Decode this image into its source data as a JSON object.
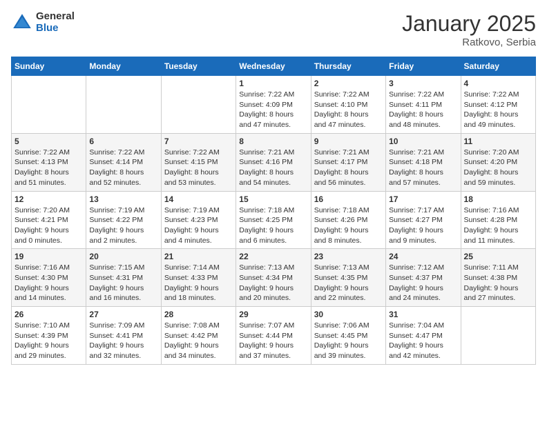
{
  "header": {
    "logo_general": "General",
    "logo_blue": "Blue",
    "title": "January 2025",
    "location": "Ratkovo, Serbia"
  },
  "days_of_week": [
    "Sunday",
    "Monday",
    "Tuesday",
    "Wednesday",
    "Thursday",
    "Friday",
    "Saturday"
  ],
  "weeks": [
    [
      {
        "day": "",
        "info": ""
      },
      {
        "day": "",
        "info": ""
      },
      {
        "day": "",
        "info": ""
      },
      {
        "day": "1",
        "info": "Sunrise: 7:22 AM\nSunset: 4:09 PM\nDaylight: 8 hours\nand 47 minutes."
      },
      {
        "day": "2",
        "info": "Sunrise: 7:22 AM\nSunset: 4:10 PM\nDaylight: 8 hours\nand 47 minutes."
      },
      {
        "day": "3",
        "info": "Sunrise: 7:22 AM\nSunset: 4:11 PM\nDaylight: 8 hours\nand 48 minutes."
      },
      {
        "day": "4",
        "info": "Sunrise: 7:22 AM\nSunset: 4:12 PM\nDaylight: 8 hours\nand 49 minutes."
      }
    ],
    [
      {
        "day": "5",
        "info": "Sunrise: 7:22 AM\nSunset: 4:13 PM\nDaylight: 8 hours\nand 51 minutes."
      },
      {
        "day": "6",
        "info": "Sunrise: 7:22 AM\nSunset: 4:14 PM\nDaylight: 8 hours\nand 52 minutes."
      },
      {
        "day": "7",
        "info": "Sunrise: 7:22 AM\nSunset: 4:15 PM\nDaylight: 8 hours\nand 53 minutes."
      },
      {
        "day": "8",
        "info": "Sunrise: 7:21 AM\nSunset: 4:16 PM\nDaylight: 8 hours\nand 54 minutes."
      },
      {
        "day": "9",
        "info": "Sunrise: 7:21 AM\nSunset: 4:17 PM\nDaylight: 8 hours\nand 56 minutes."
      },
      {
        "day": "10",
        "info": "Sunrise: 7:21 AM\nSunset: 4:18 PM\nDaylight: 8 hours\nand 57 minutes."
      },
      {
        "day": "11",
        "info": "Sunrise: 7:20 AM\nSunset: 4:20 PM\nDaylight: 8 hours\nand 59 minutes."
      }
    ],
    [
      {
        "day": "12",
        "info": "Sunrise: 7:20 AM\nSunset: 4:21 PM\nDaylight: 9 hours\nand 0 minutes."
      },
      {
        "day": "13",
        "info": "Sunrise: 7:19 AM\nSunset: 4:22 PM\nDaylight: 9 hours\nand 2 minutes."
      },
      {
        "day": "14",
        "info": "Sunrise: 7:19 AM\nSunset: 4:23 PM\nDaylight: 9 hours\nand 4 minutes."
      },
      {
        "day": "15",
        "info": "Sunrise: 7:18 AM\nSunset: 4:25 PM\nDaylight: 9 hours\nand 6 minutes."
      },
      {
        "day": "16",
        "info": "Sunrise: 7:18 AM\nSunset: 4:26 PM\nDaylight: 9 hours\nand 8 minutes."
      },
      {
        "day": "17",
        "info": "Sunrise: 7:17 AM\nSunset: 4:27 PM\nDaylight: 9 hours\nand 9 minutes."
      },
      {
        "day": "18",
        "info": "Sunrise: 7:16 AM\nSunset: 4:28 PM\nDaylight: 9 hours\nand 11 minutes."
      }
    ],
    [
      {
        "day": "19",
        "info": "Sunrise: 7:16 AM\nSunset: 4:30 PM\nDaylight: 9 hours\nand 14 minutes."
      },
      {
        "day": "20",
        "info": "Sunrise: 7:15 AM\nSunset: 4:31 PM\nDaylight: 9 hours\nand 16 minutes."
      },
      {
        "day": "21",
        "info": "Sunrise: 7:14 AM\nSunset: 4:33 PM\nDaylight: 9 hours\nand 18 minutes."
      },
      {
        "day": "22",
        "info": "Sunrise: 7:13 AM\nSunset: 4:34 PM\nDaylight: 9 hours\nand 20 minutes."
      },
      {
        "day": "23",
        "info": "Sunrise: 7:13 AM\nSunset: 4:35 PM\nDaylight: 9 hours\nand 22 minutes."
      },
      {
        "day": "24",
        "info": "Sunrise: 7:12 AM\nSunset: 4:37 PM\nDaylight: 9 hours\nand 24 minutes."
      },
      {
        "day": "25",
        "info": "Sunrise: 7:11 AM\nSunset: 4:38 PM\nDaylight: 9 hours\nand 27 minutes."
      }
    ],
    [
      {
        "day": "26",
        "info": "Sunrise: 7:10 AM\nSunset: 4:39 PM\nDaylight: 9 hours\nand 29 minutes."
      },
      {
        "day": "27",
        "info": "Sunrise: 7:09 AM\nSunset: 4:41 PM\nDaylight: 9 hours\nand 32 minutes."
      },
      {
        "day": "28",
        "info": "Sunrise: 7:08 AM\nSunset: 4:42 PM\nDaylight: 9 hours\nand 34 minutes."
      },
      {
        "day": "29",
        "info": "Sunrise: 7:07 AM\nSunset: 4:44 PM\nDaylight: 9 hours\nand 37 minutes."
      },
      {
        "day": "30",
        "info": "Sunrise: 7:06 AM\nSunset: 4:45 PM\nDaylight: 9 hours\nand 39 minutes."
      },
      {
        "day": "31",
        "info": "Sunrise: 7:04 AM\nSunset: 4:47 PM\nDaylight: 9 hours\nand 42 minutes."
      },
      {
        "day": "",
        "info": ""
      }
    ]
  ]
}
